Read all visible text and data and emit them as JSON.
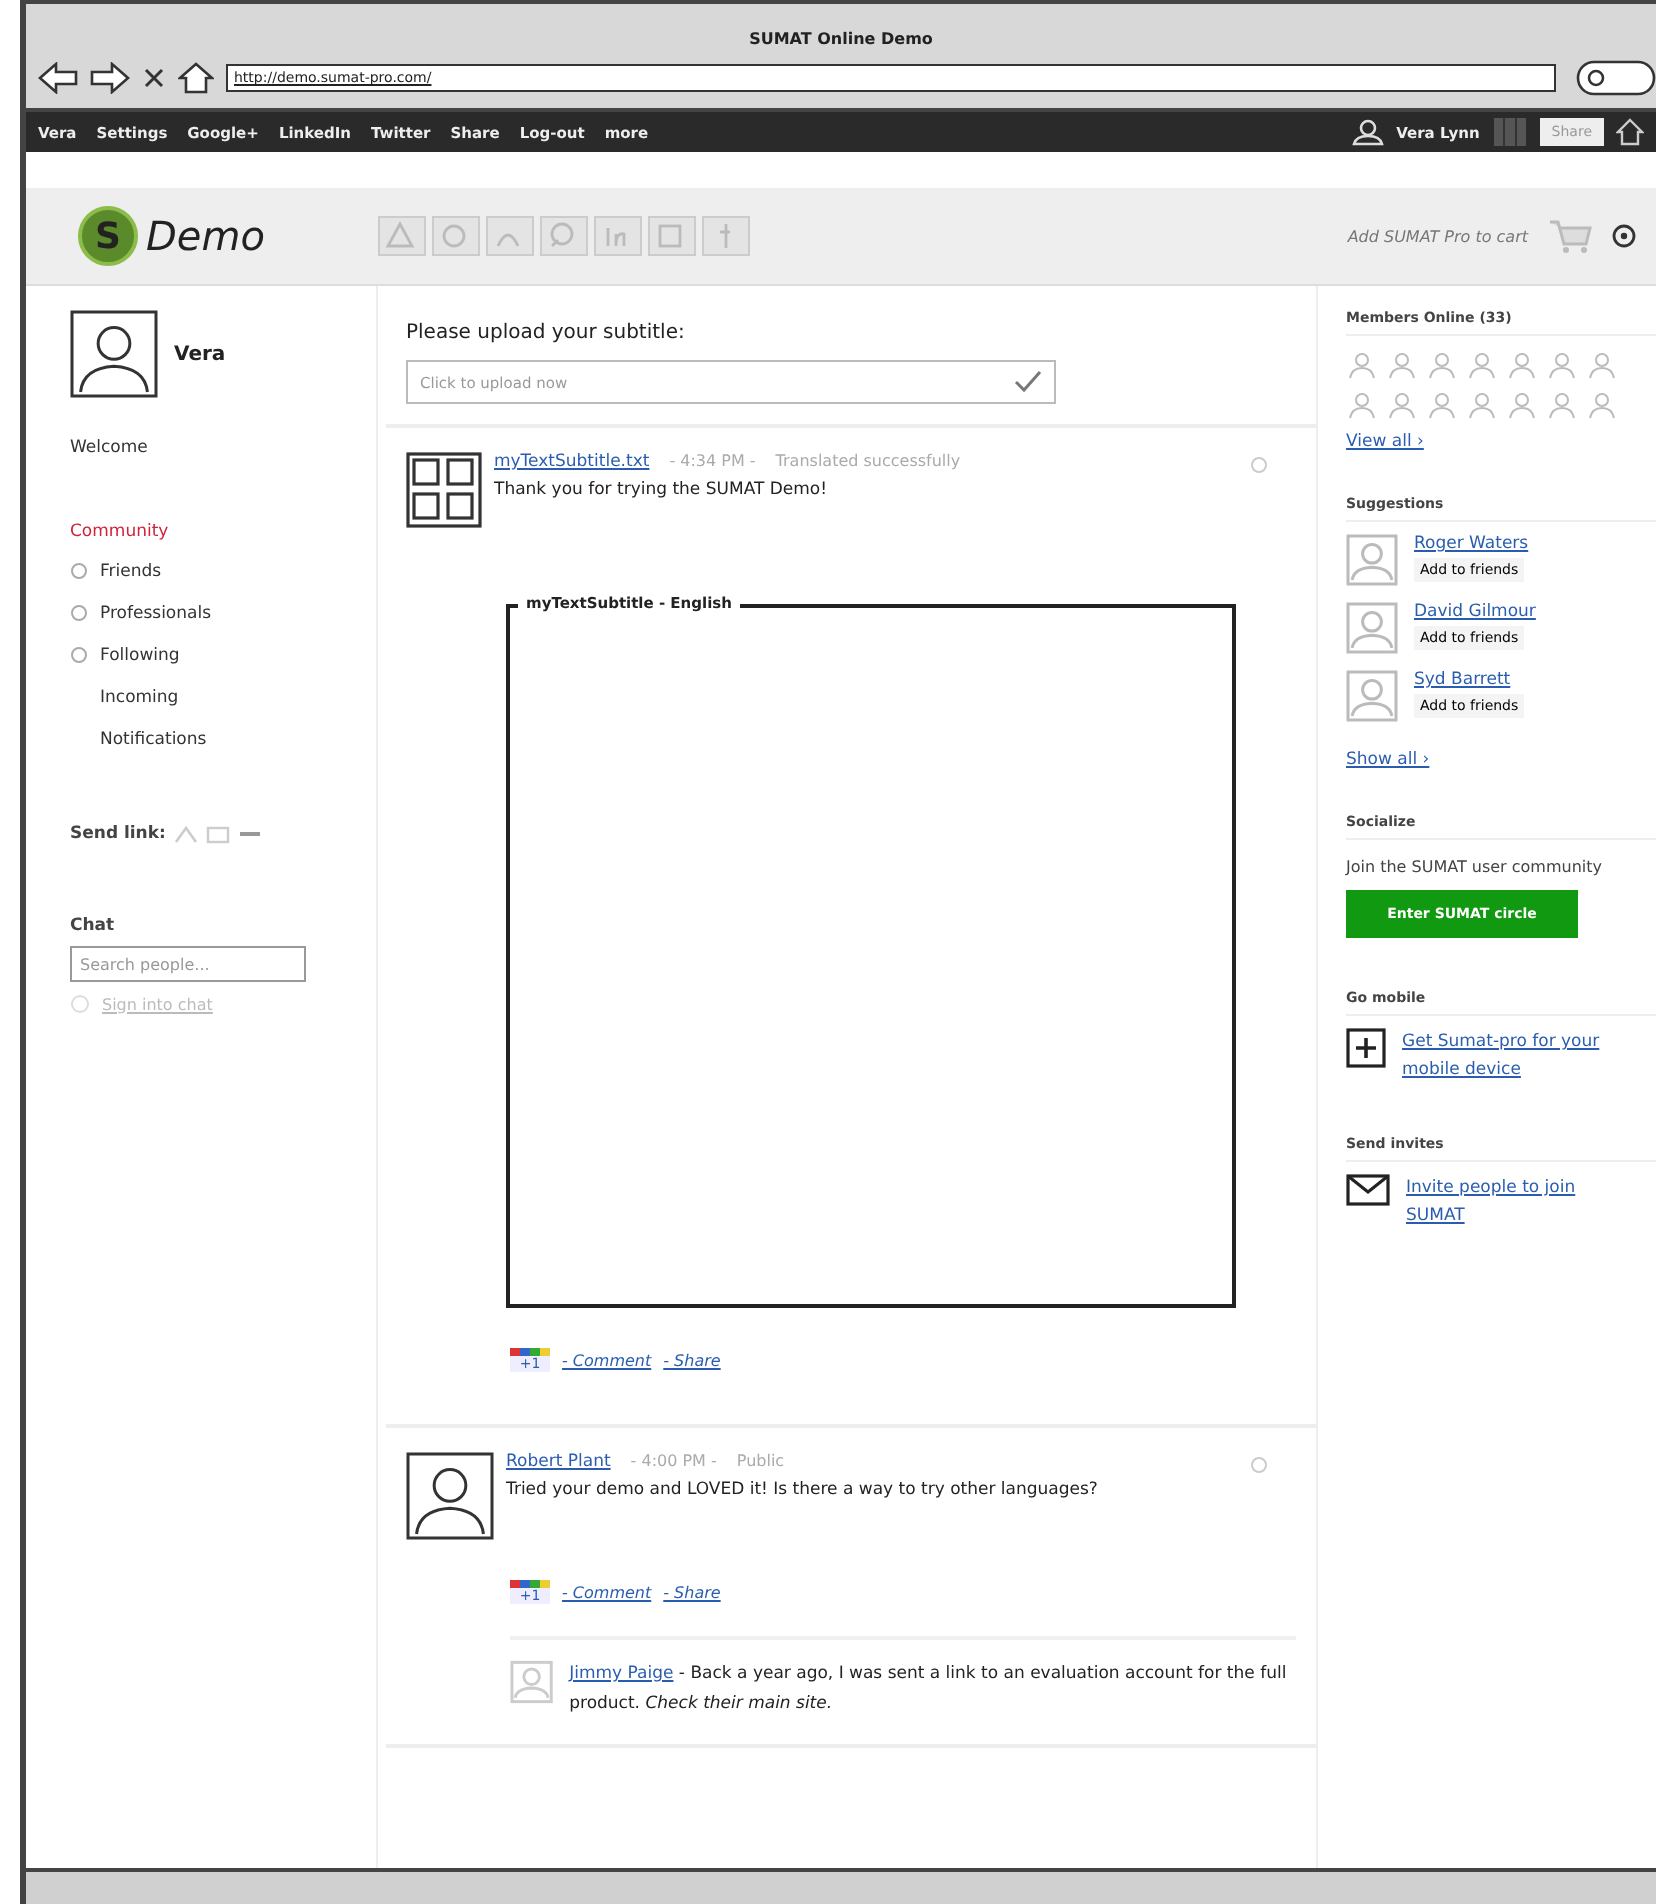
{
  "window": {
    "title": "SUMAT Online Demo",
    "address": "http://demo.sumat-pro.com/"
  },
  "topbar": {
    "items": [
      "Vera",
      "Settings",
      "Google+",
      "LinkedIn",
      "Twitter",
      "Share",
      "Log-out",
      "more"
    ],
    "user": "Vera Lynn",
    "share_button": "Share"
  },
  "header": {
    "logo_mark": "S",
    "logo_text": "Demo",
    "cart_text": "Add SUMAT Pro to cart"
  },
  "sidebar": {
    "name": "Vera",
    "welcome": "Welcome",
    "section": "Community",
    "items": [
      {
        "label": "Friends",
        "kind": "radio",
        "checked": false
      },
      {
        "label": "Professionals",
        "kind": "radio",
        "checked": false
      },
      {
        "label": "Following",
        "kind": "radio",
        "checked": false
      },
      {
        "label": "Incoming",
        "kind": "plain"
      },
      {
        "label": "Notifications",
        "kind": "plain"
      }
    ],
    "send_link": "Send link:",
    "chat": "Chat",
    "chat_search": {
      "placeholder": "Search people..."
    },
    "sign_in": "Sign into chat"
  },
  "upload": {
    "label": "Please upload your subtitle:",
    "placeholder": "Click to upload now"
  },
  "posts": [
    {
      "kind": "grid",
      "author": "myTextSubtitle.txt",
      "time": "- 4:34 PM -",
      "status": "Translated successfully",
      "body": "Thank you for trying the SUMAT Demo!",
      "subtitle_box": "myTextSubtitle - English",
      "plus_one": "+1",
      "actions": [
        "- Comment",
        "- Share"
      ]
    },
    {
      "kind": "person",
      "author": "Robert Plant",
      "time": "- 4:00 PM -",
      "status": "Public",
      "body": "Tried your demo and LOVED it! Is there a way to try other languages?",
      "plus_one": "+1",
      "actions": [
        "- Comment",
        "- Share"
      ],
      "replies": [
        {
          "author": "Jimmy Paige",
          "body": "- Back a year ago, I was sent a link to an evaluation account for the full product. *Check their main site.*"
        }
      ]
    }
  ],
  "right": {
    "members_title": "Members Online (33)",
    "view_all": "View all ›",
    "suggestions_title": "Suggestions",
    "suggestions": [
      {
        "name": "Roger Waters",
        "action": "Add to friends"
      },
      {
        "name": "David Gilmour",
        "action": "Add to friends"
      },
      {
        "name": "Syd Barrett",
        "action": "Add to friends"
      }
    ],
    "show_all": "Show all ›",
    "socialize_title": "Socialize",
    "socialize_text": "Join the SUMAT user community",
    "socialize_button": "Enter SUMAT circle",
    "mobile_title": "Go mobile",
    "mobile_link": "Get Sumat-pro for your mobile device",
    "invite_title": "Send invites",
    "invite_link": "Invite people to join SUMAT"
  }
}
